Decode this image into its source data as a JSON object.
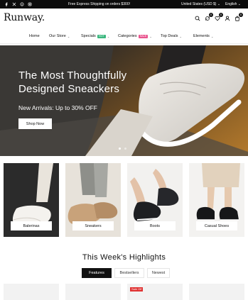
{
  "topbar": {
    "social": [
      "facebook-icon",
      "x-icon",
      "pinterest-icon",
      "instagram-icon"
    ],
    "announcement": "Free Express Shipping on orders $300!",
    "currency": "United States (USD $)",
    "language": "English"
  },
  "header": {
    "logo": "Runway.",
    "wishlist_count": "0",
    "compare_count": "0",
    "cart_count": "0"
  },
  "nav": {
    "items": [
      {
        "label": "Home"
      },
      {
        "label": "Our Store"
      },
      {
        "label": "Specials",
        "badge": "HOT",
        "badge_color": "#3bb77e"
      },
      {
        "label": "Categories",
        "badge": "SALE",
        "badge_color": "#e9548e"
      },
      {
        "label": "Top Deals"
      },
      {
        "label": "Elements"
      }
    ]
  },
  "hero": {
    "title": "The Most Thoughtfully Designed Sneackers",
    "subtitle": "New Arrivals: Up to 30% OFF",
    "button": "Shop Now"
  },
  "categories": [
    {
      "label": "Balerinas"
    },
    {
      "label": "Sneakers"
    },
    {
      "label": "Boots"
    },
    {
      "label": "Casual Shoes"
    }
  ],
  "highlights": {
    "title": "This Week's Highlights",
    "tabs": [
      "Features",
      "Bestsellers",
      "Newest"
    ],
    "sale_badge": "Sale Off"
  },
  "colors": {
    "topbar": "#0c0c0c",
    "accent": "#111111",
    "sale": "#e03232"
  }
}
